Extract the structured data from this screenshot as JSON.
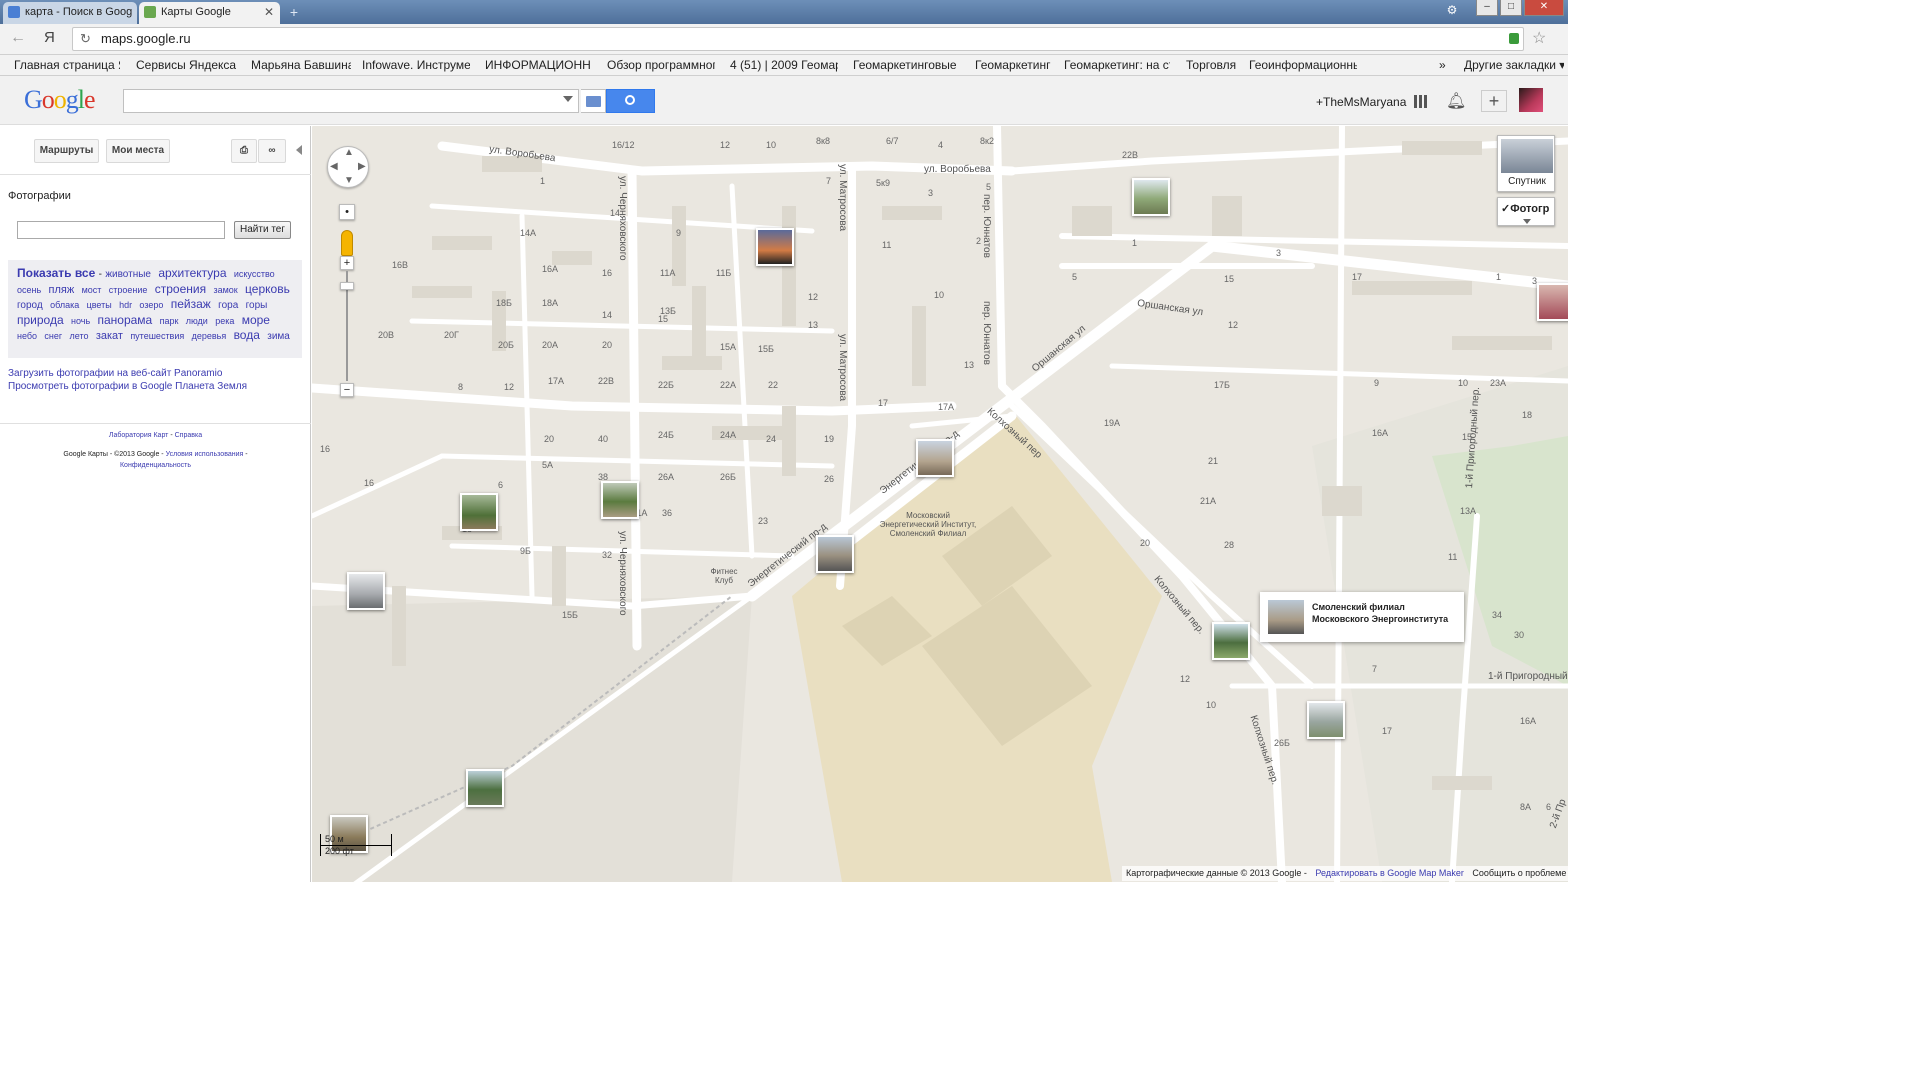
{
  "browser": {
    "tabs": [
      {
        "title": "карта - Поиск в Goog",
        "active": false
      },
      {
        "title": "Карты Google",
        "active": true
      }
    ],
    "url": "maps.google.ru",
    "bookmarks": [
      "Главная страница Я",
      "Сервисы Яндекса ▾",
      "Марьяна Бавшина",
      "Infowave. Инструмен",
      "ИНФОРМАЦИОННЬ",
      "Обзор программног",
      "4 (51) | 2009 Геомар",
      "Геомаркетинговые г",
      "Геомаркетинг",
      "Геомаркетинг: на ст",
      "Торговля",
      "Геоинформационны"
    ],
    "other_bookmarks": "Другие закладки ▾",
    "more_bookmarks": "»"
  },
  "header": {
    "logo": "Google",
    "search_value": "",
    "user_name": "+TheMsMaryana"
  },
  "left_panel": {
    "btn_routes": "Маршруты",
    "btn_my_places": "Мои места",
    "section_title": "Фотографии",
    "tag_input": "",
    "find_tag_button": "Найти тег",
    "show_all": "Показать все",
    "tags": [
      {
        "t": "животные",
        "s": 10
      },
      {
        "t": "архитектура",
        "s": 12
      },
      {
        "t": "искусство",
        "s": 9
      },
      {
        "t": "осень",
        "s": 9
      },
      {
        "t": "пляж",
        "s": 11
      },
      {
        "t": "мост",
        "s": 9
      },
      {
        "t": "строение",
        "s": 9
      },
      {
        "t": "строения",
        "s": 12
      },
      {
        "t": "замок",
        "s": 9
      },
      {
        "t": "церковь",
        "s": 12
      },
      {
        "t": "город",
        "s": 10
      },
      {
        "t": "облака",
        "s": 9
      },
      {
        "t": "цветы",
        "s": 9
      },
      {
        "t": "hdr",
        "s": 9
      },
      {
        "t": "озеро",
        "s": 9
      },
      {
        "t": "пейзаж",
        "s": 12
      },
      {
        "t": "гора",
        "s": 10
      },
      {
        "t": "горы",
        "s": 10
      },
      {
        "t": "природа",
        "s": 12
      },
      {
        "t": "ночь",
        "s": 9
      },
      {
        "t": "панорама",
        "s": 12
      },
      {
        "t": "парк",
        "s": 9
      },
      {
        "t": "люди",
        "s": 9
      },
      {
        "t": "река",
        "s": 9
      },
      {
        "t": "море",
        "s": 12
      },
      {
        "t": "небо",
        "s": 9
      },
      {
        "t": "снег",
        "s": 9
      },
      {
        "t": "лето",
        "s": 9
      },
      {
        "t": "закат",
        "s": 11
      },
      {
        "t": "путешествия",
        "s": 9
      },
      {
        "t": "деревья",
        "s": 9
      },
      {
        "t": "вода",
        "s": 12
      },
      {
        "t": "зима",
        "s": 10
      }
    ],
    "link_upload": "Загрузить фотографии на веб-сайт Panoramio",
    "link_earth": "Просмотреть фотографии в Google Планета Земля",
    "lab": "Лаборатория Карт",
    "help": "Справка",
    "copyright": "Google Карты - ©2013 Google -",
    "terms": "Условия использования",
    "privacy": "Конфиденциальность"
  },
  "map": {
    "layer_satellite": "Спутник",
    "layer_photos": "Фотогр",
    "infowindow_title": "Смоленский филиал Московского Энергоинститута",
    "poi_institute": "Московский Энергетический Институт, Смоленский Филиал",
    "poi_fitness": "Фитнес Клуб",
    "scale_m": "50 м",
    "scale_ft": "200 фт",
    "footer_data": "Картографические данные © 2013 Google -",
    "footer_edit": "Редактировать в Google Map Maker",
    "footer_report": "Сообщить о проблеме",
    "streets": [
      "ул. Воробьева",
      "ул. Воробьева",
      "ул. Матросова",
      "ул. Матросова",
      "ул. Черняховского",
      "ул. Черняховского",
      "пер. Юннатов",
      "пер. Юннатов",
      "Оршанская ул",
      "Оршанская ул",
      "Колхозный пер",
      "Колхозный пер.",
      "Колхозный пер.",
      "Энергетический пр-д",
      "Энергетический пр-д",
      "1-й Пригородный пер.",
      "1-й Пригородный",
      "2-й Пр"
    ],
    "numbers": [
      "16/12",
      "12",
      "10",
      "8к8",
      "6/7",
      "4",
      "8к2",
      "22В",
      "1",
      "7",
      "5к9",
      "3",
      "5",
      "14",
      "14А",
      "9",
      "11",
      "2",
      "16В",
      "16А",
      "16",
      "11А",
      "11Б",
      "1",
      "3",
      "18Б",
      "18А",
      "14",
      "13Б",
      "12",
      "10",
      "5",
      "15",
      "17",
      "1",
      "3",
      "20В",
      "20Г",
      "20Б",
      "20А",
      "20",
      "15",
      "15А",
      "15Б",
      "13",
      "13",
      "12",
      "8",
      "12",
      "17А",
      "22В",
      "22Б",
      "22А",
      "22",
      "17",
      "17А",
      "17Б",
      "9",
      "10",
      "23А",
      "16",
      "18",
      "20",
      "40",
      "24Б",
      "24А",
      "24",
      "19",
      "19А",
      "16А",
      "16",
      "5А",
      "6",
      "38",
      "26А",
      "26Б",
      "26",
      "21",
      "21А",
      "18",
      "9Б",
      "11А",
      "36",
      "32",
      "23",
      "20",
      "28",
      "11",
      "13А",
      "15Б",
      "34",
      "30",
      "15",
      "15А",
      "15Б",
      "8",
      "12",
      "10",
      "17",
      "16А",
      "26Б",
      "8А",
      "6",
      "7"
    ]
  }
}
